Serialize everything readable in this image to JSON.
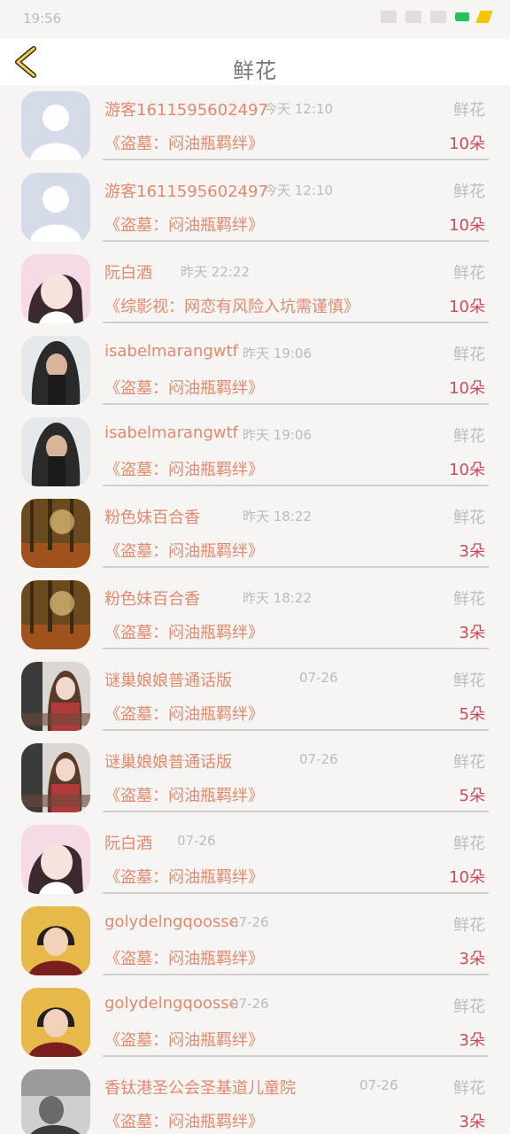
{
  "statusbar": {
    "time": "19:56"
  },
  "header": {
    "title": "鲜花"
  },
  "rows": [
    {
      "name": "游客1611595602497",
      "time": "今天 12:10",
      "gift": "鲜花",
      "work": "《盗墓：闷油瓶羁绊》",
      "count": "10朵"
    },
    {
      "name": "游客1611595602497",
      "time": "今天 12:10",
      "gift": "鲜花",
      "work": "《盗墓：闷油瓶羁绊》",
      "count": "10朵"
    },
    {
      "name": "阮白酒",
      "time": "昨天 22:22",
      "gift": "鲜花",
      "work": "《综影视：网恋有风险入坑需谨慎》",
      "count": "10朵"
    },
    {
      "name": "isabelmarangwtf",
      "time": "昨天 19:06",
      "gift": "鲜花",
      "work": "《盗墓：闷油瓶羁绊》",
      "count": "10朵"
    },
    {
      "name": "isabelmarangwtf",
      "time": "昨天 19:06",
      "gift": "鲜花",
      "work": "《盗墓：闷油瓶羁绊》",
      "count": "10朵"
    },
    {
      "name": "粉色妹百合香",
      "time": "昨天 18:22",
      "gift": "鲜花",
      "work": "《盗墓：闷油瓶羁绊》",
      "count": "3朵"
    },
    {
      "name": "粉色妹百合香",
      "time": "昨天 18:22",
      "gift": "鲜花",
      "work": "《盗墓：闷油瓶羁绊》",
      "count": "3朵"
    },
    {
      "name": "谜巢娘娘普通话版",
      "time": "07-26",
      "gift": "鲜花",
      "work": "《盗墓：闷油瓶羁绊》",
      "count": "5朵"
    },
    {
      "name": "谜巢娘娘普通话版",
      "time": "07-26",
      "gift": "鲜花",
      "work": "《盗墓：闷油瓶羁绊》",
      "count": "5朵"
    },
    {
      "name": "阮白酒",
      "time": "07-26",
      "gift": "鲜花",
      "work": "《盗墓：闷油瓶羁绊》",
      "count": "10朵"
    },
    {
      "name": "golydelngqoosse",
      "time": "07-26",
      "gift": "鲜花",
      "work": "《盗墓：闷油瓶羁绊》",
      "count": "3朵"
    },
    {
      "name": "golydelngqoosse",
      "time": "07-26",
      "gift": "鲜花",
      "work": "《盗墓：闷油瓶羁绊》",
      "count": "3朵"
    },
    {
      "name": "香钛港圣公会圣基道儿童院",
      "time": "07-26",
      "gift": "鲜花",
      "work": "《盗墓：闷油瓶羁绊》",
      "count": "3朵"
    }
  ]
}
